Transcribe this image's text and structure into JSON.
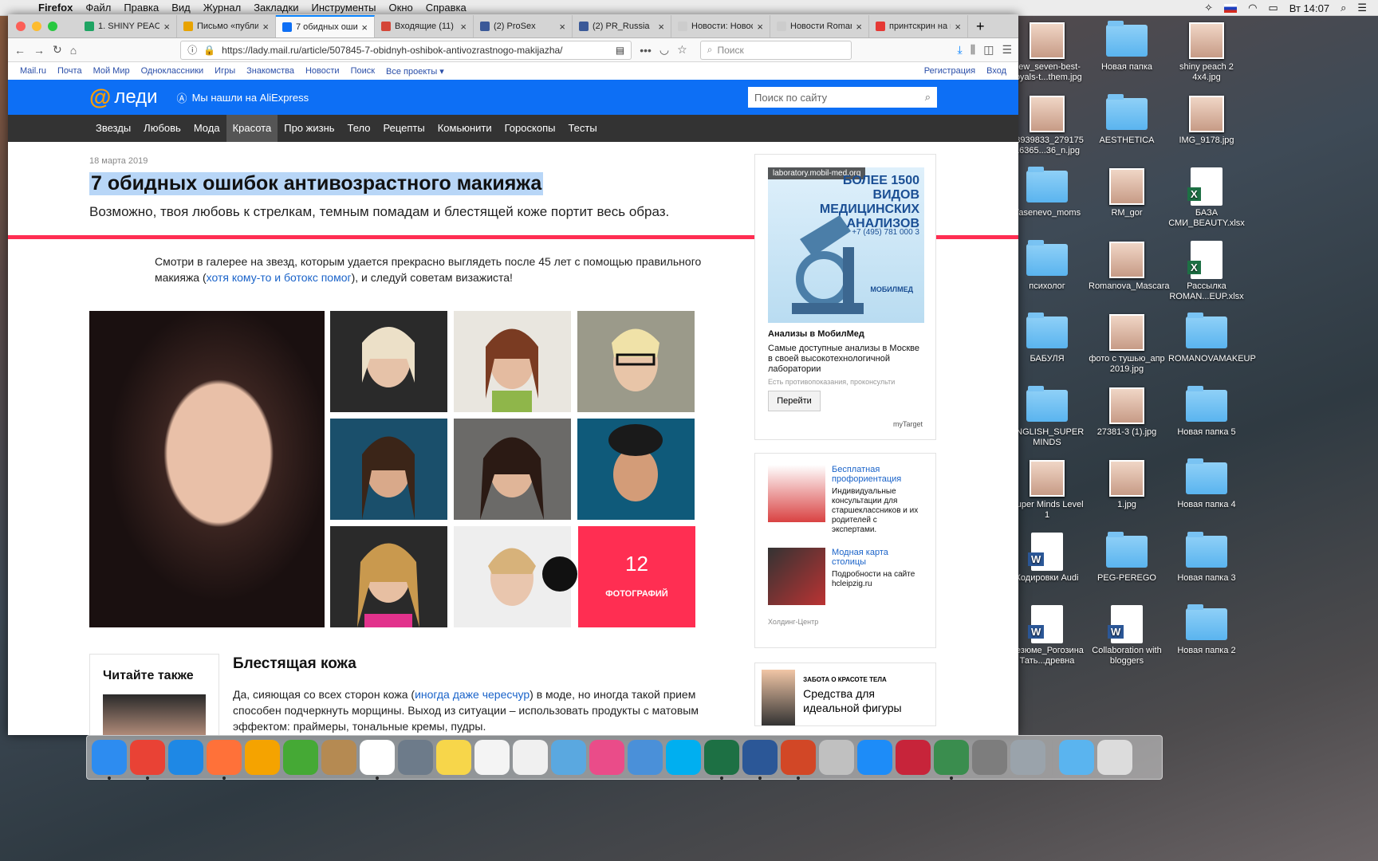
{
  "menubar": {
    "app": "Firefox",
    "items": [
      "Файл",
      "Правка",
      "Вид",
      "Журнал",
      "Закладки",
      "Инструменты",
      "Окно",
      "Справка"
    ],
    "clock": "Вт 14:07"
  },
  "tabs": [
    {
      "title": "1. SHINY PEACH",
      "color": "#1fa463"
    },
    {
      "title": "Письмо «публик",
      "color": "#e8a300"
    },
    {
      "title": "7 обидных ошиб",
      "color": "#0d6ff5",
      "active": true
    },
    {
      "title": "Входящие (11) - ",
      "color": "#d44638"
    },
    {
      "title": "(2) ProSex",
      "color": "#3b5998"
    },
    {
      "title": "(2) PR_Russia",
      "color": "#3b5998"
    },
    {
      "title": "Новости: Новость: Д",
      "color": "#cccccc"
    },
    {
      "title": "Новости Romano",
      "color": "#cccccc"
    },
    {
      "title": "принтскрин на м",
      "color": "#e53935"
    }
  ],
  "navbar": {
    "url": "https://lady.mail.ru/article/507845-7-obidnyh-oshibok-antivozrastnogo-makijazha/",
    "search_placeholder": "Поиск"
  },
  "portal": {
    "links": [
      "Mail.ru",
      "Почта",
      "Мой Мир",
      "Одноклассники",
      "Игры",
      "Знакомства",
      "Новости",
      "Поиск",
      "Все проекты ▾"
    ],
    "register": "Регистрация",
    "login": "Вход"
  },
  "header": {
    "logo": "леди",
    "ali": "Мы нашли на AliExpress",
    "search_placeholder": "Поиск по сайту"
  },
  "categories": [
    "Звезды",
    "Любовь",
    "Мода",
    "Красота",
    "Про жизнь",
    "Тело",
    "Рецепты",
    "Комьюнити",
    "Гороскопы",
    "Тесты"
  ],
  "article": {
    "date": "18 марта 2019",
    "title": "7 обидных ошибок антивозрастного макияжа",
    "subtitle": "Возможно, твоя любовь к стрелкам, темным помадам и блестящей коже портит весь образ.",
    "intro_a": "Смотри в галерее на звезд, которым удается прекрасно выглядеть после 45 лет с помощью правильного макияжа (",
    "intro_link": "хотя кому-то и ботокс помог",
    "intro_b": "), и следуй советам визажиста!",
    "gallery_count": "12",
    "gallery_label": "ФОТОГРАФИЙ",
    "read_also": "Читайте также",
    "h2": "Блестящая кожа",
    "para_a": "Да, сияющая со всех сторон кожа (",
    "para_link": "иногда даже чересчур",
    "para_b": ") в моде, но иногда такой прием способен подчеркнуть морщины. Выход из ситуации – использовать продукты с матовым эффектом: праймеры, тональные кремы, пудры."
  },
  "ads": {
    "ad1": {
      "domain": "laboratory.mobil-med.org",
      "headline": "БОЛЕЕ 1500 ВИДОВ МЕДИЦИНСКИХ АНАЛИЗОВ",
      "phone": "+7 (495) 781 000 3",
      "brand": "МОБИЛМЕД",
      "title": "Анализы в МобилМед",
      "desc": "Самые доступные анализы в Москве в своей высокотехнологичной лаборатории",
      "small": "Есть противопоказания, проконсульти",
      "button": "Перейти",
      "network": "myTarget"
    },
    "ad2": {
      "items": [
        {
          "title": "Бесплатная профориентация",
          "desc": "Индивидуальные консультации для старшеклассников и их родителей с экспертами."
        },
        {
          "title": "Модная карта столицы",
          "desc": "Подробности на сайте hcleipzig.ru"
        }
      ],
      "footer": "Холдинг-Центр"
    },
    "ad3": {
      "kicker": "ЗАБОТА О КРАСОТЕ ТЕЛА",
      "title": "Средства для идеальной фигуры"
    }
  },
  "desktop": [
    {
      "label": "new_seven-best-royals-t...them.jpg",
      "type": "photo"
    },
    {
      "label": "Новая папка",
      "type": "folder"
    },
    {
      "label": "shiny peach 2 4x4.jpg",
      "type": "photo"
    },
    {
      "label": "53939833_279175 16365...36_n.jpg",
      "type": "photo"
    },
    {
      "label": "AESTHETICA",
      "type": "folder"
    },
    {
      "label": "IMG_9178.jpg",
      "type": "photo"
    },
    {
      "label": "Yasenevo_moms",
      "type": "folder"
    },
    {
      "label": "RM_gor",
      "type": "photo"
    },
    {
      "label": "БАЗА СМИ_BEAUTY.xlsx",
      "type": "xls"
    },
    {
      "label": "психолог",
      "type": "folder"
    },
    {
      "label": "Romanova_Mascara",
      "type": "photo"
    },
    {
      "label": "Рассылка ROMAN...EUP.xlsx",
      "type": "xls"
    },
    {
      "label": "БАБУЛЯ",
      "type": "folder"
    },
    {
      "label": "фото с тушью_апр 2019.jpg",
      "type": "photo"
    },
    {
      "label": "ROMANOVAMAKEUP",
      "type": "folder"
    },
    {
      "label": "ENGLISH_SUPER MINDS",
      "type": "folder"
    },
    {
      "label": "27381-3 (1).jpg",
      "type": "photo"
    },
    {
      "label": "Новая папка 5",
      "type": "folder"
    },
    {
      "label": "Super Minds Level 1",
      "type": "photo"
    },
    {
      "label": "1.jpg",
      "type": "photo"
    },
    {
      "label": "Новая папка 4",
      "type": "folder"
    },
    {
      "label": "Кодировки Audi",
      "type": "doc"
    },
    {
      "label": "PEG-PEREGO",
      "type": "folder"
    },
    {
      "label": "Новая папка 3",
      "type": "folder"
    },
    {
      "label": "Резюме_Рогозина Тать...древна",
      "type": "doc"
    },
    {
      "label": "Collaboration with bloggers",
      "type": "doc"
    },
    {
      "label": "Новая папка 2",
      "type": "folder"
    }
  ],
  "dock": [
    "Finder",
    "Chrome",
    "Safari",
    "Firefox",
    "Infuse",
    "uTorrent",
    "Contacts",
    "Calendar",
    "Launchpad",
    "Notes",
    "Reminders",
    "Photos",
    "Preview",
    "iTunes",
    "Printer",
    "Skype",
    "Excel",
    "Word",
    "PowerPoint",
    "Mac",
    "App Store",
    "Parallels",
    "Migration",
    "Settings",
    "Disk",
    "Folder",
    "Trash"
  ]
}
